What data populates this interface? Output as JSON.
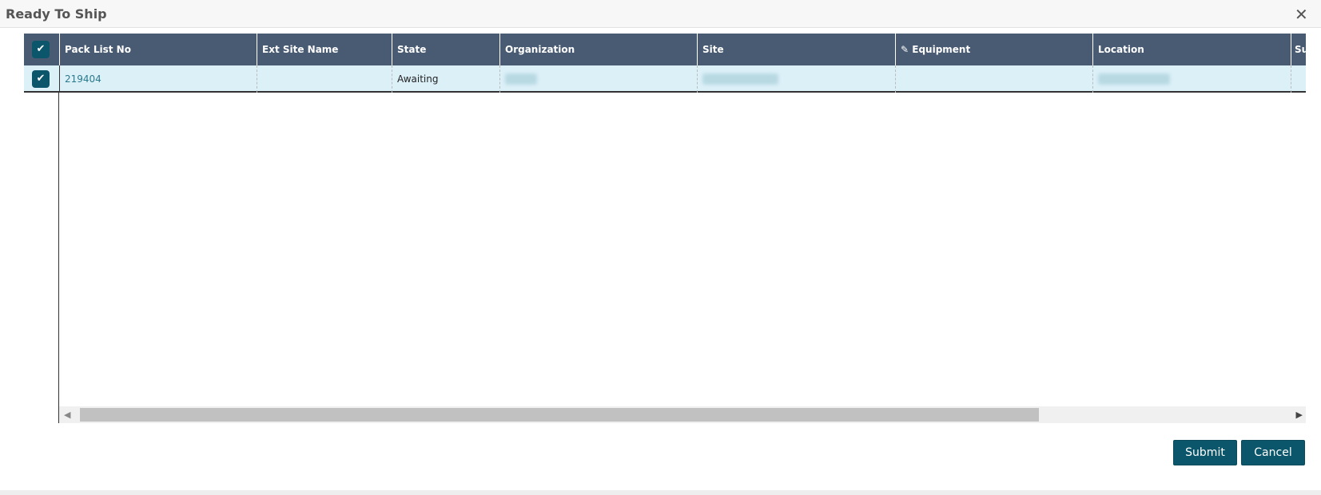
{
  "dialog": {
    "title": "Ready To Ship",
    "close_icon": "close-icon"
  },
  "grid": {
    "columns": [
      "Pack List No",
      "Ext Site Name",
      "State",
      "Organization",
      "Site",
      "Equipment",
      "Location",
      "Su"
    ],
    "rows": [
      {
        "pack_list_no": "219404",
        "ext_site_name": "",
        "state": "Awaiting",
        "organization": "",
        "site": "",
        "equipment": "",
        "location": ""
      }
    ]
  },
  "buttons": {
    "submit": "Submit",
    "cancel": "Cancel"
  }
}
